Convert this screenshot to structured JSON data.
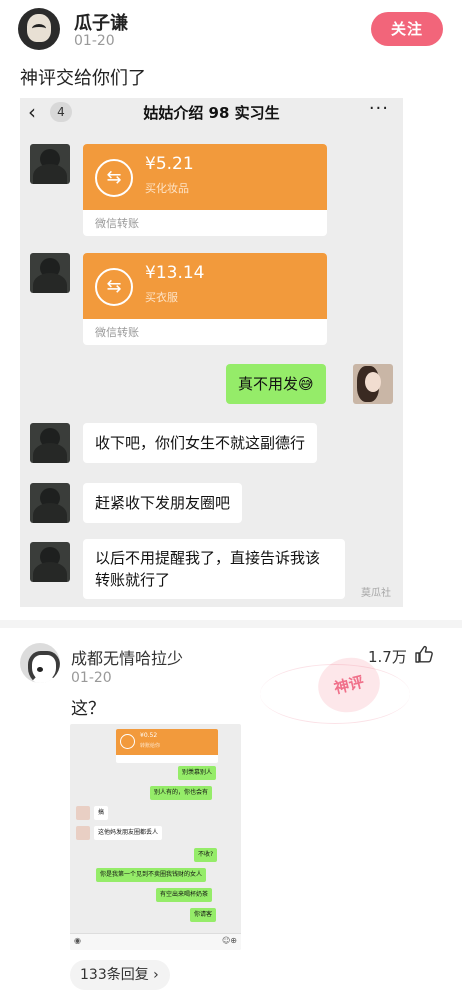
{
  "post": {
    "author": "瓜子谦",
    "date": "01-20",
    "follow_label": "关注",
    "text": "神评交给你们了"
  },
  "chat_shot": {
    "back_icon": "chevron-left-icon",
    "unread": "4",
    "title": "姑姑介绍 98 实习生",
    "more": "···",
    "transfers": [
      {
        "amount": "¥5.21",
        "note": "买化妆品",
        "footer": "微信转账"
      },
      {
        "amount": "¥13.14",
        "note": "买衣服",
        "footer": "微信转账"
      }
    ],
    "messages": [
      {
        "from": "me",
        "text": "真不用发😅"
      },
      {
        "from": "other",
        "text": "收下吧，你们女生不就这副德行"
      },
      {
        "from": "other",
        "text": "赶紧收下发朋友圈吧"
      },
      {
        "from": "other",
        "text": "以后不用提醒我了，直接告诉我该转账就行了"
      }
    ],
    "watermark": "莫瓜社"
  },
  "comment": {
    "author": "成都无情哈拉少",
    "date": "01-20",
    "likes": "1.7万",
    "stamp": "神评",
    "text": "这？",
    "reply_label": "133条回复 ›",
    "mini_shot": {
      "transfer_amount": "¥0.52",
      "transfer_note": "转账给你",
      "messages": [
        {
          "from": "me",
          "text": "别羡慕别人"
        },
        {
          "from": "me",
          "text": "别人有的，你也会有"
        },
        {
          "from": "other",
          "text": "搞"
        },
        {
          "from": "other",
          "text": "这他妈发朋友圈都丢人"
        },
        {
          "from": "me",
          "text": "不收?"
        },
        {
          "from": "me",
          "text": "你是我第一个见到不卖圈我钱财的女人"
        },
        {
          "from": "me",
          "text": "有空出来喝杯奶茶"
        },
        {
          "from": "me",
          "text": "你请客"
        }
      ]
    }
  }
}
